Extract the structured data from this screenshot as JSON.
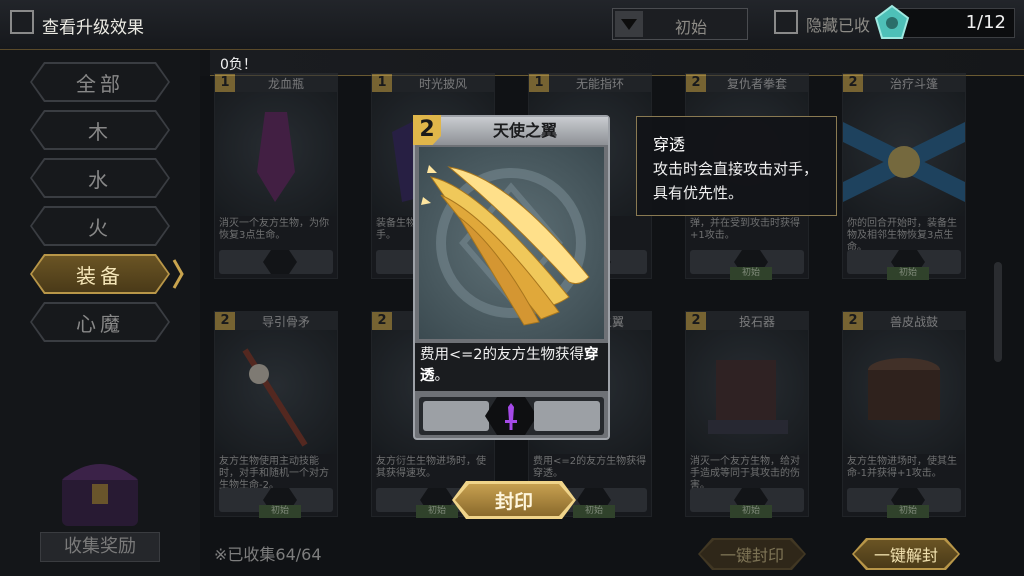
{
  "topbar": {
    "view_upgrade_label": "查看升级效果",
    "sort_value": "初始",
    "hide_label": "隐藏已收",
    "progress_text": "1/12"
  },
  "banner": {
    "text": "0负！"
  },
  "sidebar": {
    "items": [
      {
        "label": "全部",
        "active": false
      },
      {
        "label": "木",
        "active": false
      },
      {
        "label": "水",
        "active": false
      },
      {
        "label": "火",
        "active": false
      },
      {
        "label": "装备",
        "active": true
      },
      {
        "label": "心魔",
        "active": false
      }
    ],
    "reward_label": "收集奖励"
  },
  "cards": [
    {
      "cost": "1",
      "name": "龙血瓶",
      "desc": "消灭一个友方生物，为你恢复3点生命。",
      "tag": ""
    },
    {
      "cost": "1",
      "name": "时光披风",
      "desc": "装备生物……且未死……手。",
      "tag": ""
    },
    {
      "cost": "1",
      "name": "无能指环",
      "desc": "",
      "tag": ""
    },
    {
      "cost": "2",
      "name": "复仇者拳套",
      "desc": "弹，并在受到攻击时获得+1攻击。",
      "tag": "初始"
    },
    {
      "cost": "2",
      "name": "治疗斗篷",
      "desc": "你的回合开始时，装备生物及相邻生物恢复3点生命。",
      "tag": "初始"
    },
    {
      "cost": "2",
      "name": "导引骨矛",
      "desc": "友方生物使用主动技能时，对手和随机一个对方生物生命-2。",
      "tag": "初始"
    },
    {
      "cost": "2",
      "name": "…",
      "desc": "友方衍生生物进场时，使其获得速攻。",
      "tag": "初始"
    },
    {
      "cost": "2",
      "name": "天使之翼",
      "desc": "费用<=2的友方生物获得穿透。",
      "tag": "初始"
    },
    {
      "cost": "2",
      "name": "投石器",
      "desc": "消灭一个友方生物，给对手造成等同于其攻击的伤害。",
      "tag": "初始"
    },
    {
      "cost": "2",
      "name": "兽皮战鼓",
      "desc": "友方生物进场时，使其生命-1并获得+1攻击。",
      "tag": "初始"
    }
  ],
  "popup": {
    "cost": "2",
    "name": "天使之翼",
    "desc_prefix": "费用<=2的友方生物获得",
    "desc_keyword": "穿透",
    "desc_suffix": "。"
  },
  "tooltip": {
    "title": "穿透",
    "body": "攻击时会直接攻击对手，具有优先性。"
  },
  "footer": {
    "collected_text": "※已收集64/64",
    "seal_button": "封印",
    "seal_all_button": "一键封印",
    "unseal_all_button": "一键解封"
  },
  "colors": {
    "accent_gold": "#c9a44e",
    "equip_purple": "#8a3ad8"
  }
}
